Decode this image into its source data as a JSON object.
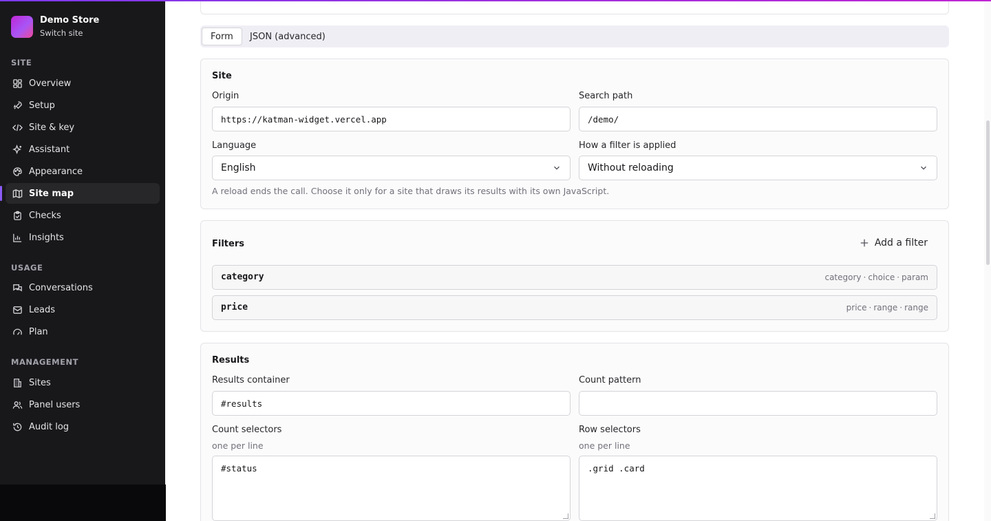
{
  "brand": {
    "name": "Demo Store",
    "switch_label": "Switch site"
  },
  "nav": {
    "site_heading": "SITE",
    "site_items": [
      {
        "label": "Overview",
        "icon": "grid-icon"
      },
      {
        "label": "Setup",
        "icon": "rocket-icon"
      },
      {
        "label": "Site & key",
        "icon": "code-icon"
      },
      {
        "label": "Assistant",
        "icon": "sparkles-icon"
      },
      {
        "label": "Appearance",
        "icon": "palette-icon"
      },
      {
        "label": "Site map",
        "icon": "map-icon",
        "active": true
      },
      {
        "label": "Checks",
        "icon": "clipboard-check-icon"
      },
      {
        "label": "Insights",
        "icon": "bar-chart-icon"
      }
    ],
    "usage_heading": "USAGE",
    "usage_items": [
      {
        "label": "Conversations",
        "icon": "chat-icon"
      },
      {
        "label": "Leads",
        "icon": "inbox-icon"
      },
      {
        "label": "Plan",
        "icon": "gauge-icon"
      }
    ],
    "management_heading": "MANAGEMENT",
    "management_items": [
      {
        "label": "Sites",
        "icon": "building-icon"
      },
      {
        "label": "Panel users",
        "icon": "users-icon"
      },
      {
        "label": "Audit log",
        "icon": "history-icon"
      }
    ]
  },
  "tabs": [
    {
      "label": "Form",
      "active": true
    },
    {
      "label": "JSON (advanced)"
    }
  ],
  "site_card": {
    "title": "Site",
    "origin_label": "Origin",
    "origin_value": "https://katman-widget.vercel.app",
    "search_path_label": "Search path",
    "search_path_value": "/demo/",
    "language_label": "Language",
    "language_value": "English",
    "filter_mode_label": "How a filter is applied",
    "filter_mode_value": "Without reloading",
    "hint": "A reload ends the call. Choose it only for a site that draws its results with its own JavaScript."
  },
  "filters_card": {
    "title": "Filters",
    "add_label": "Add a filter",
    "rows": [
      {
        "name": "category",
        "meta": [
          "category",
          "choice",
          "param"
        ]
      },
      {
        "name": "price",
        "meta": [
          "price",
          "range",
          "range"
        ]
      }
    ]
  },
  "results_card": {
    "title": "Results",
    "container_label": "Results container",
    "container_value": "#results",
    "count_pattern_label": "Count pattern",
    "count_pattern_value": "",
    "count_selectors_label": "Count selectors",
    "count_selectors_sub": "one per line",
    "count_selectors_value": "#status",
    "row_selectors_label": "Row selectors",
    "row_selectors_sub": "one per line",
    "row_selectors_value": ".grid .card"
  },
  "colors": {
    "accent": "#8b5cf6",
    "sidebar_bg": "#18181b"
  }
}
